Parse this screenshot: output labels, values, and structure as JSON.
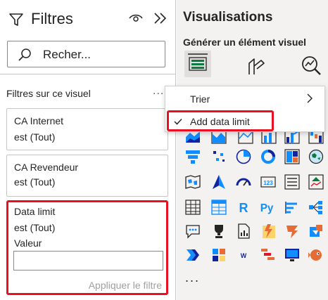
{
  "filters": {
    "title": "Filtres",
    "search_placeholder": "Recher...",
    "section_title": "Filtres sur ce visuel",
    "section_more": "...",
    "cards": [
      {
        "name": "CA Internet",
        "state": "est (Tout)"
      },
      {
        "name": "CA Revendeur",
        "state": "est (Tout)"
      },
      {
        "name": "Data limit",
        "state": "est (Tout)",
        "value_label": "Valeur",
        "value": "",
        "apply_label": "Appliquer le filtre"
      }
    ]
  },
  "visualizations": {
    "title": "Visualisations",
    "subtitle": "Générer un élément visuel",
    "more_label": "...",
    "icons": [
      "area-chart-icon",
      "stacked-area-chart-icon",
      "line-column-chart-icon",
      "line-stacked-column-chart-icon",
      "ribbon-chart-icon",
      "waterfall-chart-icon",
      "funnel-chart-icon",
      "scatter-chart-icon",
      "pie-chart-icon",
      "donut-chart-icon",
      "treemap-icon",
      "map-icon",
      "filled-map-icon",
      "azure-map-icon",
      "gauge-icon",
      "card-icon",
      "multi-row-card-icon",
      "kpi-icon",
      "slicer-icon",
      "table-icon",
      "matrix-icon",
      "r-visual-icon",
      "python-visual-icon",
      "key-influencers-icon",
      "decomposition-tree-icon",
      "qa-icon",
      "goals-icon",
      "paginated-report-icon",
      "smart-narrative-icon",
      "power-apps-icon",
      "power-automate-icon",
      "custom-visual-icon",
      "word-cloud-icon",
      "gantt-icon",
      "monitor-visual-icon",
      "fish-visual-icon"
    ]
  },
  "menu": {
    "sort_label": "Trier",
    "data_limit_label": "Add data limit"
  },
  "colors": {
    "highlight": "#e81123",
    "accent": "#118dff",
    "pane_bg": "#f3f2f1"
  }
}
